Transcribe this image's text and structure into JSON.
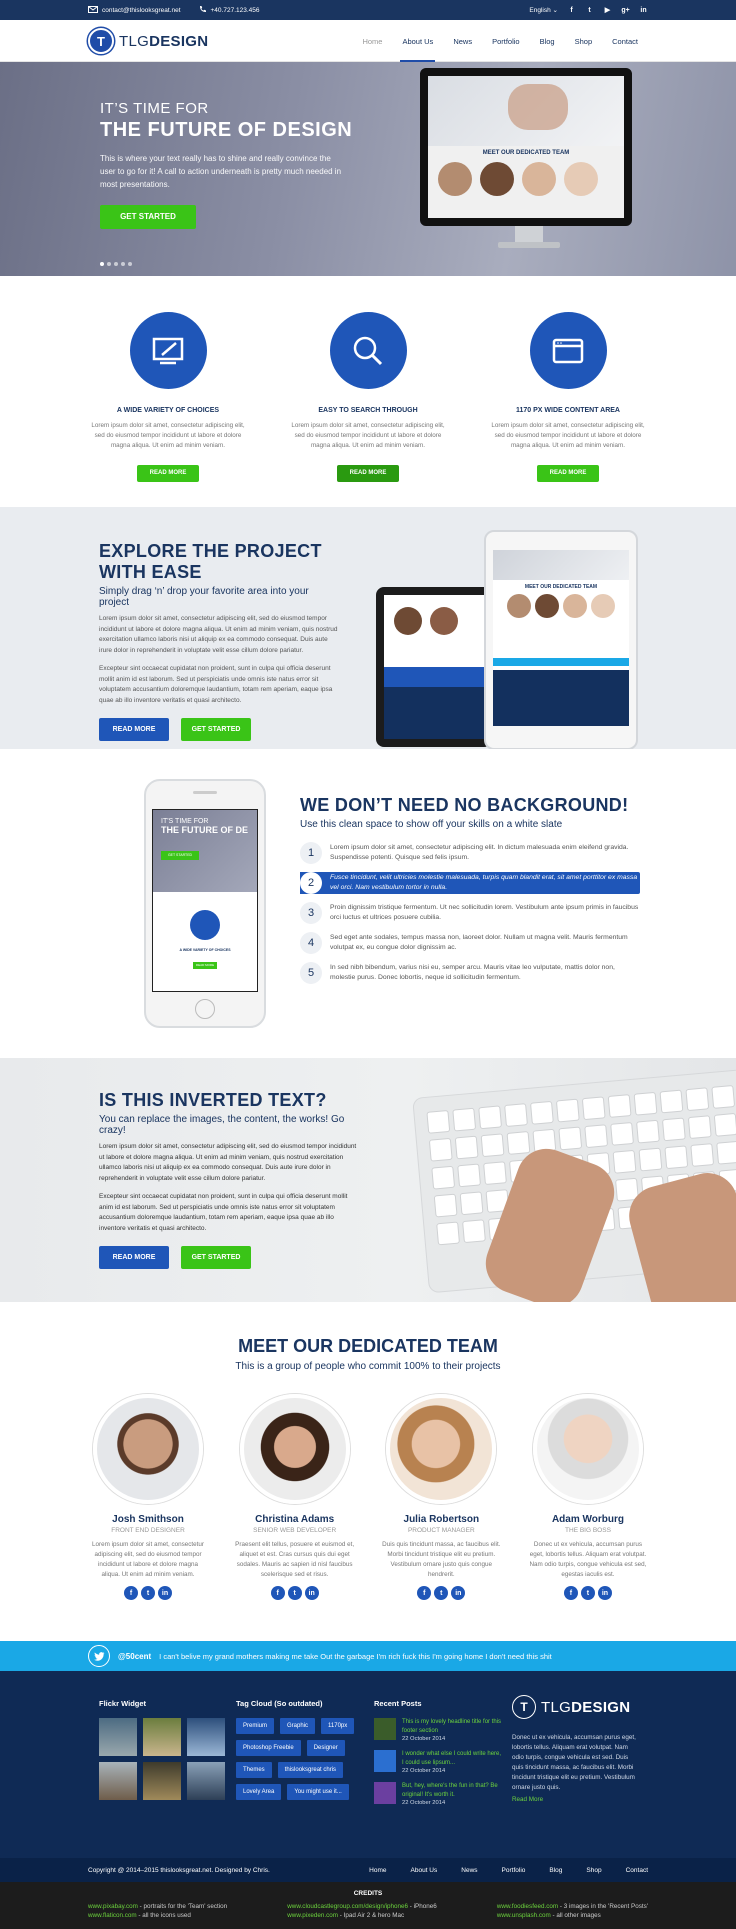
{
  "topbar": {
    "email": "contact@thislooksgreat.net",
    "phone": "+40.727.123.456",
    "language": "English",
    "social_icons": [
      "facebook-icon",
      "twitter-icon",
      "youtube-icon",
      "google-plus-icon",
      "linkedin-icon"
    ]
  },
  "header": {
    "logo_letter": "T",
    "logo_light": "TLG",
    "logo_bold": "DESIGN",
    "nav": [
      "Home",
      "About Us",
      "News",
      "Portfolio",
      "Blog",
      "Shop",
      "Contact"
    ],
    "active_nav": "About Us"
  },
  "hero": {
    "pre_title": "IT’S TIME FOR",
    "title": "THE FUTURE OF DESIGN",
    "description": "This is where your text really has to shine and really convince the user to go for it! A call to action underneath is pretty much needed in most presentations.",
    "button": "GET STARTED",
    "slide_count": 5,
    "active_slide": 1,
    "screen_heading": "MEET OUR DEDICATED TEAM"
  },
  "features": [
    {
      "icon": "design-tablet-icon",
      "title": "A WIDE VARIETY OF CHOICES",
      "desc": "Lorem ipsum dolor sit amet, consectetur adipiscing elit, sed do eiusmod tempor incididunt ut labore et dolore magna aliqua. Ut enim ad minim veniam.",
      "button": "READ MORE"
    },
    {
      "icon": "search-icon",
      "title": "EASY TO SEARCH THROUGH",
      "desc": "Lorem ipsum dolor sit amet, consectetur adipiscing elit, sed do eiusmod tempor incididunt ut labore et dolore magna aliqua. Ut enim ad minim veniam.",
      "button": "READ MORE"
    },
    {
      "icon": "browser-window-icon",
      "title": "1170 PX WIDE CONTENT AREA",
      "desc": "Lorem ipsum dolor sit amet, consectetur adipiscing elit, sed do eiusmod tempor incididunt ut labore et dolore magna aliqua. Ut enim ad minim veniam.",
      "button": "READ MORE"
    }
  ],
  "explore": {
    "title": "EXPLORE THE PROJECT WITH EASE",
    "subtitle": "Simply drag ‘n’ drop your favorite area into your project",
    "para1": "Lorem ipsum dolor sit amet, consectetur adipiscing elit, sed do eiusmod tempor incididunt ut labore et dolore magna aliqua. Ut enim ad minim veniam, quis nostrud exercitation ullamco laboris nisi ut aliquip ex ea commodo consequat. Duis aute irure dolor in reprehenderit in voluptate velit esse cillum dolore pariatur.",
    "para2": "Excepteur sint occaecat cupidatat non proident, sunt in culpa qui officia deserunt mollit anim id est laborum. Sed ut perspiciatis unde omnis iste natus error sit voluptatem accusantium doloremque laudantium, totam rem aperiam, eaque ipsa quae ab illo inventore veritatis et quasi architecto.",
    "btn_primary": "READ MORE",
    "btn_secondary": "GET STARTED",
    "screen_heading": "MEET OUR DEDICATED TEAM"
  },
  "nobg": {
    "title": "WE DON’T NEED NO BACKGROUND!",
    "subtitle": "Use this clean space to show off your skills on a white slate",
    "phone_pre": "IT'S TIME FOR",
    "phone_title": "THE FUTURE OF DE",
    "phone_button": "GET STARTED",
    "phone_feature": "A WIDE VARIETY OF CHOICES",
    "phone_feature_button": "READ MORE",
    "items": [
      {
        "num": "1",
        "text": "Lorem ipsum dolor sit amet, consectetur adipiscing elit. In dictum malesuada enim eleifend gravida. Suspendisse potenti. Quisque sed felis ipsum."
      },
      {
        "num": "2",
        "text": "Fusce tincidunt, velit ultricies molestie malesuada, turpis quam blandit erat, sit amet porttitor ex massa vel orci. Nam vestibulum tortor in nulla."
      },
      {
        "num": "3",
        "text": "Proin dignissim tristique fermentum. Ut nec sollicitudin lorem. Vestibulum ante ipsum primis in faucibus orci luctus et ultrices posuere cubilia."
      },
      {
        "num": "4",
        "text": "Sed eget ante sodales, tempus massa non, laoreet dolor. Nullam ut magna velit. Mauris fermentum volutpat ex, eu congue dolor dignissim ac."
      },
      {
        "num": "5",
        "text": "In sed nibh bibendum, varius nisi eu, semper arcu. Mauris vitae leo vulputate, mattis dolor non, molestie purus. Donec lobortis, neque id sollicitudin fermentum."
      }
    ],
    "highlighted": "2"
  },
  "inverted": {
    "title": "IS THIS INVERTED TEXT?",
    "subtitle": "You can replace the images, the content, the works! Go crazy!",
    "para1": "Lorem ipsum dolor sit amet, consectetur adipiscing elit, sed do eiusmod tempor incididunt ut labore et dolore magna aliqua. Ut enim ad minim veniam, quis nostrud exercitation ullamco laboris nisi ut aliquip ex ea commodo consequat. Duis aute irure dolor in reprehenderit in voluptate velit esse cillum dolore pariatur.",
    "para2": "Excepteur sint occaecat cupidatat non proident, sunt in culpa qui officia deserunt mollit anim id est laborum. Sed ut perspiciatis unde omnis iste natus error sit voluptatem accusantium doloremque laudantium, totam rem aperiam, eaque ipsa quae ab illo inventore veritatis et quasi architecto.",
    "btn_primary": "READ MORE",
    "btn_secondary": "GET STARTED"
  },
  "team": {
    "title": "MEET OUR DEDICATED TEAM",
    "subtitle": "This is a group of people who commit 100% to their projects",
    "members": [
      {
        "name": "Josh Smithson",
        "role": "FRONT END DESIGNER",
        "desc": "Lorem ipsum dolor sit amet, consectetur adipiscing elit, sed do eiusmod tempor incididunt ut labore et dolore magna aliqua. Ut enim ad minim veniam."
      },
      {
        "name": "Christina Adams",
        "role": "SENIOR WEB DEVELOPER",
        "desc": "Praesent elit tellus, posuere et euismod et, aliquet et est. Cras cursus quis dui eget sodales. Mauris ac sapien id nisl faucibus scelerisque sed et risus."
      },
      {
        "name": "Julia Robertson",
        "role": "PRODUCT MANAGER",
        "desc": "Duis quis tincidunt massa, ac faucibus elit. Morbi tincidunt tristique elit eu pretium. Vestibulum ornare justo quis congue hendrerit."
      },
      {
        "name": "Adam Worburg",
        "role": "THE BIG BOSS",
        "desc": "Donec ut ex vehicula, accumsan purus eget, lobortis tellus. Aliquam erat volutpat. Nam odio turpis, congue vehicula est sed, egestas iaculis est."
      }
    ]
  },
  "twitter": {
    "user": "@50cent",
    "text": "I can't belive my grand mothers making me take Out the garbage I'm rich fuck this I'm going home I don't need this shit"
  },
  "footer": {
    "flickr_title": "Flickr Widget",
    "tags_title": "Tag Cloud (So outdated)",
    "tags": [
      "Premium",
      "Graphic",
      "1170px",
      "Photoshop Freebie",
      "Designer",
      "Themes",
      "thislooksgreat chris",
      "Lovely Area",
      "You might use it..."
    ],
    "recent_title": "Recent Posts",
    "posts": [
      {
        "title": "This is my lovely headline title for this footer section",
        "date": "22 October 2014"
      },
      {
        "title": "I wonder what else I could write here, I could use lipsum...",
        "date": "22 October 2014"
      },
      {
        "title": "But, hey, where's the fun in that? Be original! It's worth it.",
        "date": "22 October 2014"
      }
    ],
    "about": "Donec ut ex vehicula, accumsan purus eget, lobortis tellus. Aliquam erat volutpat. Nam odio turpis, congue vehicula est sed. Duis quis tincidunt massa, ac faucibus elit. Morbi tincidunt tristique elit eu pretium. Vestibulum ornare justo quis.",
    "read_more": "Read More"
  },
  "bottom": {
    "copyright": "Copyright @ 2014–2015 thislooksgreat.net. Designed by Chris.",
    "nav": [
      "Home",
      "About Us",
      "News",
      "Portfolio",
      "Blog",
      "Shop",
      "Contact"
    ]
  },
  "credits": {
    "title": "CREDITS",
    "c1a_link": "www.pixabay.com",
    "c1a_text": " - portraits for the 'Team' section",
    "c1b_link": "www.flaticon.com",
    "c1b_text": " - all the icons used",
    "c2a_link": "www.cloudcastlegroup.com/design/iphone6",
    "c2a_text": " - iPhone6",
    "c2b_link": "www.pixeden.com",
    "c2b_text": " - Ipad Air 2 & hero Mac",
    "c3a_link": "www.foodiesfeed.com",
    "c3a_text": " - 3 images in the 'Recent Posts'",
    "c3b_link": "www.unsplash.com",
    "c3b_text": " - all other images"
  },
  "colors": {
    "navy": "#1a3560",
    "blue": "#1f56b8",
    "green": "#3ac417",
    "twitter": "#1aa8e6"
  }
}
